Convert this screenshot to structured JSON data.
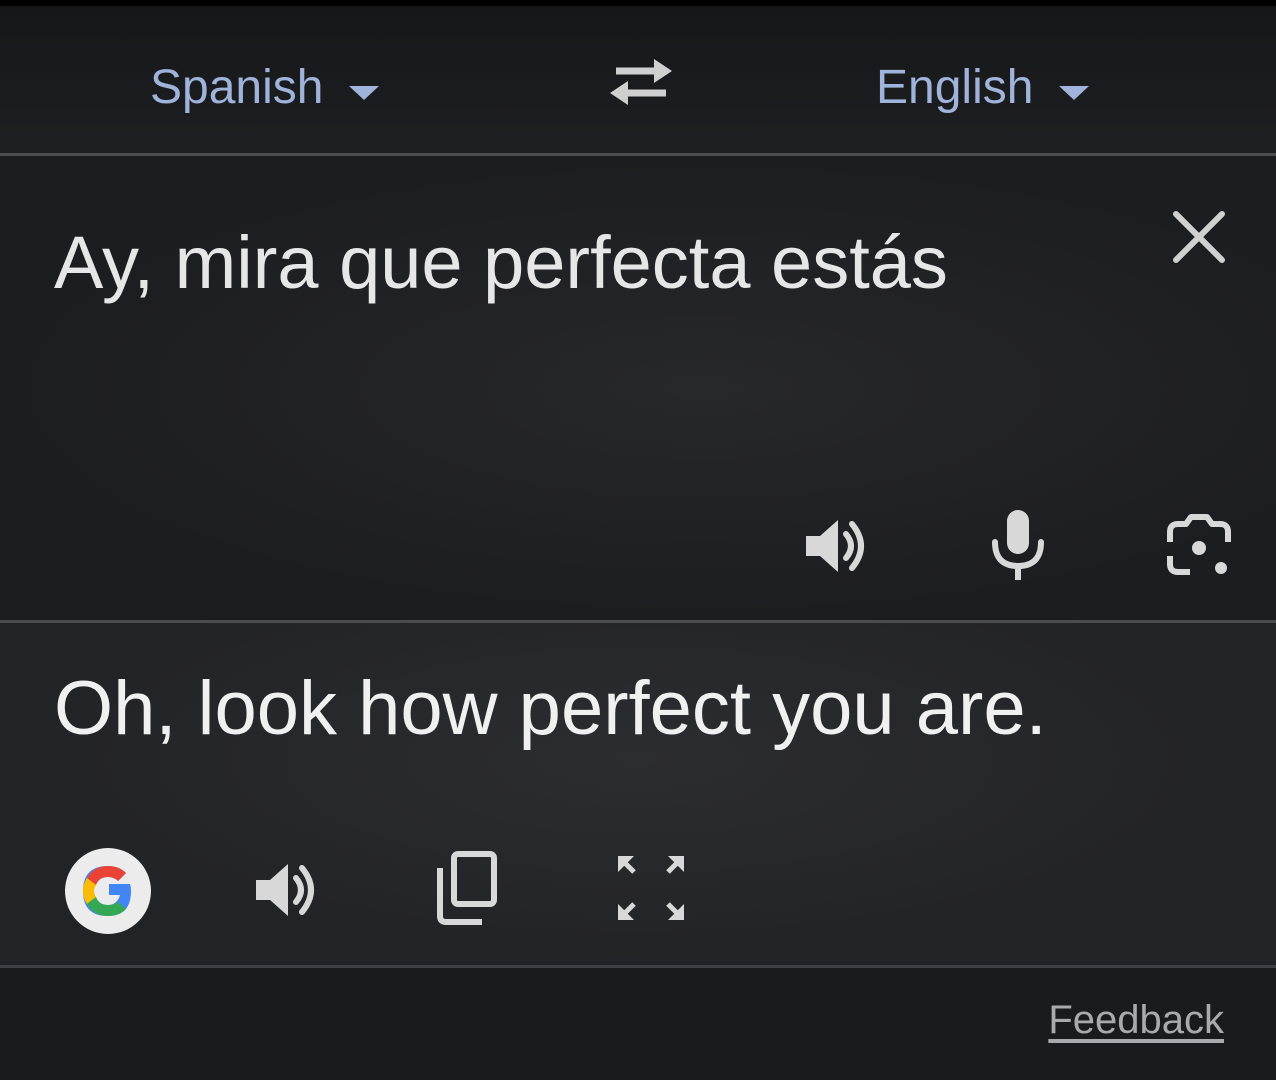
{
  "languages": {
    "source": "Spanish",
    "target": "English"
  },
  "source": {
    "text": "Ay, mira que perfecta estás"
  },
  "translation": {
    "text": "Oh, look how perfect you are."
  },
  "footer": {
    "feedback_label": "Feedback"
  },
  "icons": {
    "swap": "swap-arrows-icon",
    "clear": "close-icon",
    "source_listen": "speaker-icon",
    "mic": "microphone-icon",
    "camera": "camera-lens-icon",
    "google": "google-logo",
    "target_listen": "speaker-icon",
    "copy": "copy-icon",
    "fullscreen": "fullscreen-icon"
  },
  "colors": {
    "accent": "#9fb3db",
    "text": "#e6e6e6",
    "icon": "#d8d8d8"
  }
}
